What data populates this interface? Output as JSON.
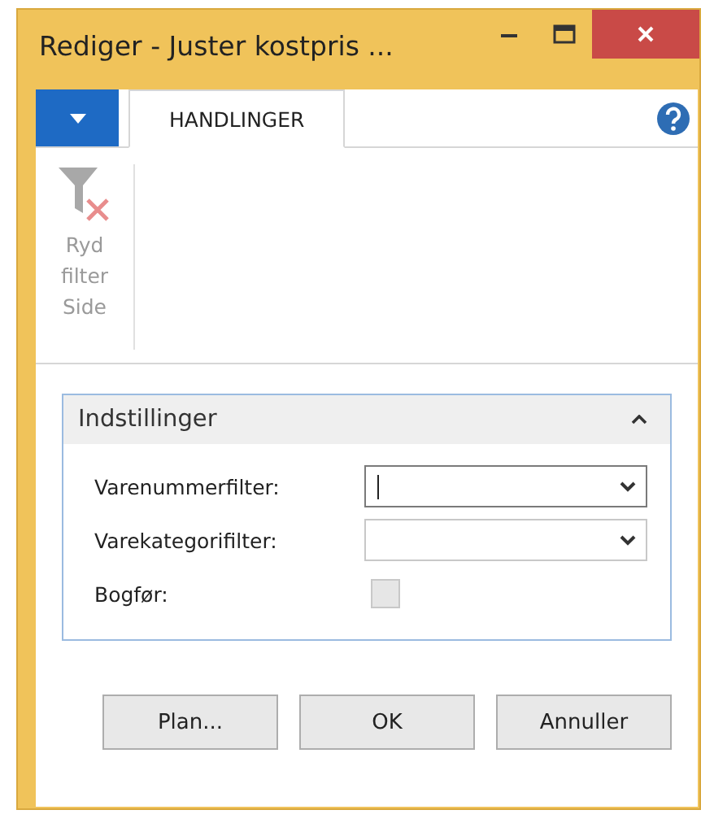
{
  "window": {
    "title": "Rediger - Juster kostpris ..."
  },
  "tabs": [
    {
      "label": "HANDLINGER",
      "selected": true
    }
  ],
  "ribbon": {
    "actions": [
      {
        "label": "Ryd filter",
        "disabled": true
      }
    ],
    "group": "Side"
  },
  "section": {
    "title": "Indstillinger",
    "expanded": true,
    "fields": [
      {
        "kind": "dropdown",
        "label": "Varenummerfilter:",
        "focused": true
      },
      {
        "kind": "dropdown",
        "label": "Varekategorifilter:",
        "focused": false
      },
      {
        "kind": "checkbox",
        "label": "Bogfør:",
        "checked": false,
        "disabled": true
      }
    ]
  },
  "buttons": [
    "Plan...",
    "OK",
    "Annuller"
  ]
}
